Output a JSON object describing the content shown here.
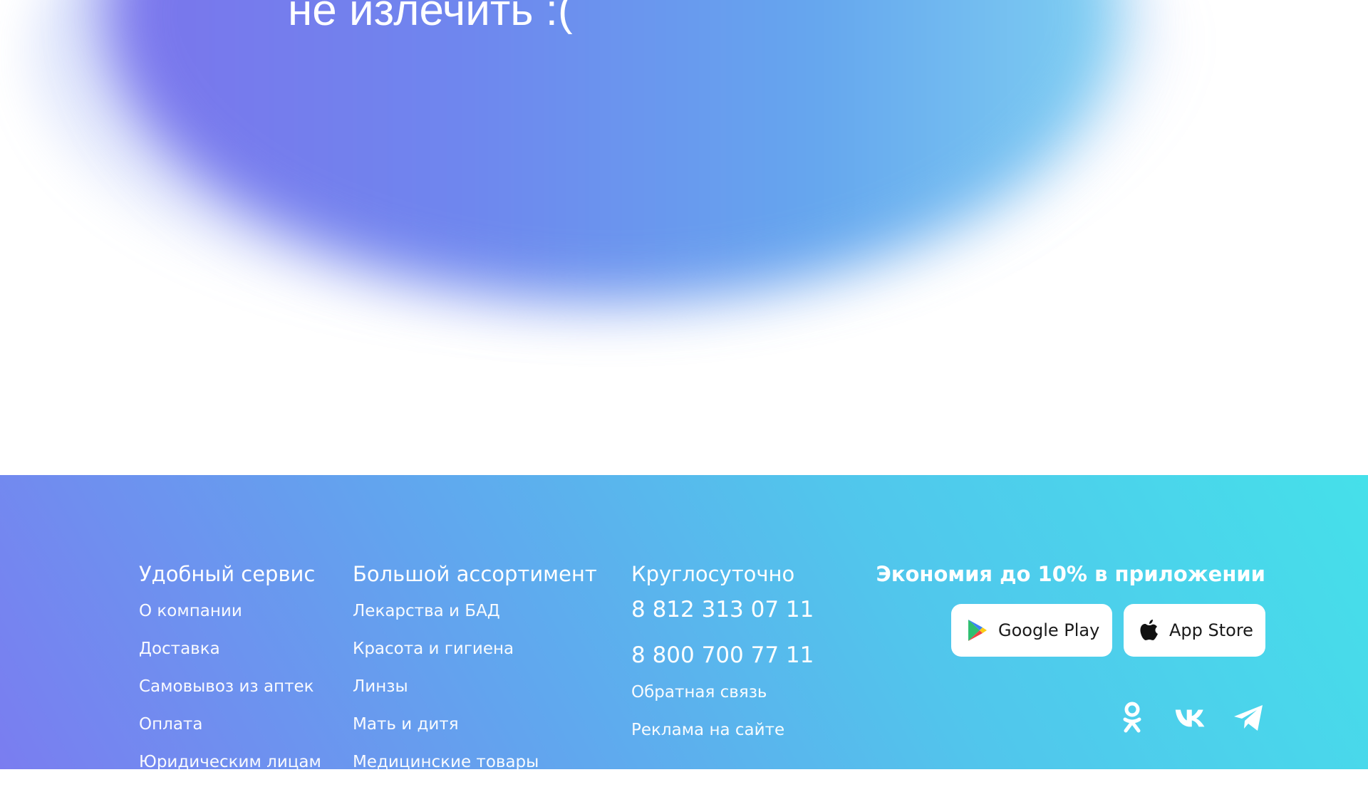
{
  "hero": {
    "message": "не излечить :("
  },
  "footer": {
    "service": {
      "title": "Удобный сервис",
      "links": [
        "О компании",
        "Доставка",
        "Самовывоз из аптек",
        "Оплата",
        "Юридическим лицам"
      ]
    },
    "assortment": {
      "title": "Большой ассортимент",
      "links": [
        "Лекарства и БАД",
        "Красота и гигиена",
        "Линзы",
        "Мать и дитя",
        "Медицинские товары"
      ]
    },
    "support": {
      "title": "Круглосуточно",
      "phones": [
        "8 812 313 07 11",
        "8 800 700 77 11"
      ],
      "links": [
        "Обратная связь",
        "Реклама на сайте"
      ]
    },
    "app": {
      "title": "Экономия до 10% в приложении",
      "google_play_label": "Google Play",
      "app_store_label": "App Store",
      "google_play_icon": "google-play-icon",
      "app_store_icon": "apple-icon"
    },
    "social": {
      "icons": [
        "odnoklassniki-icon",
        "vk-icon",
        "telegram-icon"
      ]
    }
  },
  "colors": {
    "footer_gradient_start": "#7a7df0",
    "footer_gradient_end": "#45e0ea",
    "hero_blob_purple": "#7b74ec",
    "hero_blob_blue": "#65a6ee",
    "text": "#ffffff"
  }
}
